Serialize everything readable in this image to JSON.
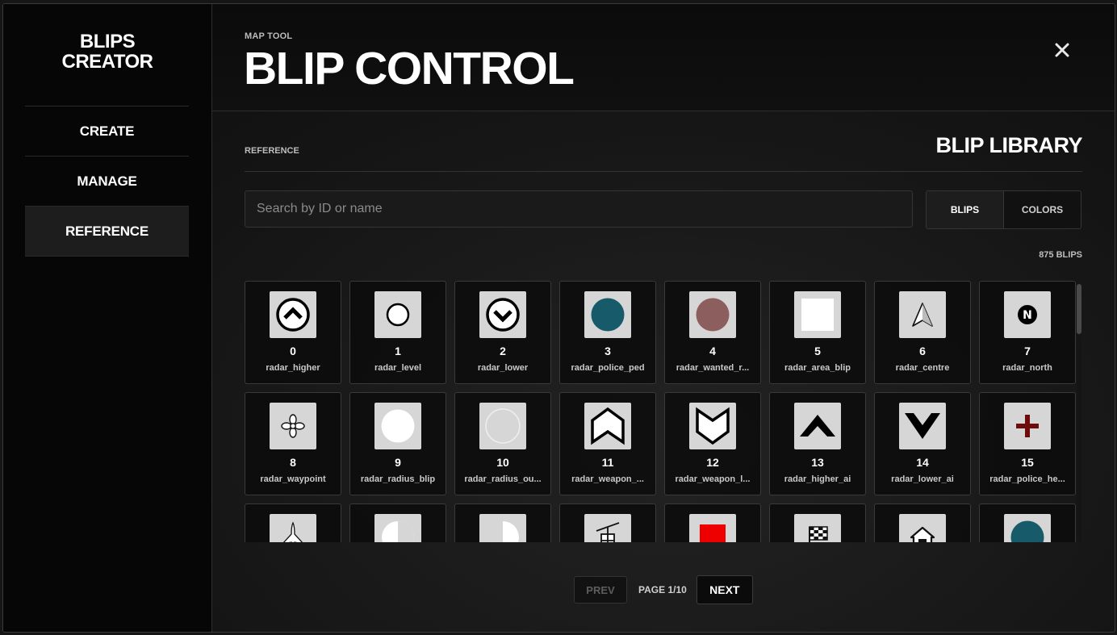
{
  "brand": {
    "line1": "BLIPS",
    "line2": "CREATOR"
  },
  "nav": [
    {
      "label": "CREATE",
      "active": false
    },
    {
      "label": "MANAGE",
      "active": false
    },
    {
      "label": "REFERENCE",
      "active": true
    }
  ],
  "header": {
    "eyebrow": "MAP TOOL",
    "title": "BLIP CONTROL"
  },
  "section": {
    "label": "REFERENCE",
    "title": "BLIP LIBRARY"
  },
  "search": {
    "placeholder": "Search by ID or name",
    "value": ""
  },
  "toggle": {
    "blips": "BLIPS",
    "colors": "COLORS",
    "selected": "BLIPS"
  },
  "count": "875 BLIPS",
  "blips": [
    {
      "id": "0",
      "name": "radar_higher",
      "icon": "circle-chevron-up-icon"
    },
    {
      "id": "1",
      "name": "radar_level",
      "icon": "circle-outline-icon"
    },
    {
      "id": "2",
      "name": "radar_lower",
      "icon": "circle-chevron-down-icon"
    },
    {
      "id": "3",
      "name": "radar_police_ped",
      "icon": "teal-dot-icon"
    },
    {
      "id": "4",
      "name": "radar_wanted_r...",
      "icon": "mauve-dot-icon"
    },
    {
      "id": "5",
      "name": "radar_area_blip",
      "icon": "white-square-icon"
    },
    {
      "id": "6",
      "name": "radar_centre",
      "icon": "navigation-arrow-icon"
    },
    {
      "id": "7",
      "name": "radar_north",
      "icon": "north-marker-icon"
    },
    {
      "id": "8",
      "name": "radar_waypoint",
      "icon": "waypoint-icon"
    },
    {
      "id": "9",
      "name": "radar_radius_blip",
      "icon": "white-circle-icon"
    },
    {
      "id": "10",
      "name": "radar_radius_ou...",
      "icon": "faint-circle-icon"
    },
    {
      "id": "11",
      "name": "radar_weapon_...",
      "icon": "chevron-up-outline-icon"
    },
    {
      "id": "12",
      "name": "radar_weapon_l...",
      "icon": "chevron-down-outline-icon"
    },
    {
      "id": "13",
      "name": "radar_higher_ai",
      "icon": "chevron-up-solid-icon"
    },
    {
      "id": "14",
      "name": "radar_lower_ai",
      "icon": "chevron-down-solid-icon"
    },
    {
      "id": "15",
      "name": "radar_police_he...",
      "icon": "red-cross-icon"
    },
    {
      "id": "",
      "name": "",
      "icon": "jet-icon"
    },
    {
      "id": "",
      "name": "",
      "icon": "half-circle-left-icon"
    },
    {
      "id": "",
      "name": "",
      "icon": "half-circle-right-icon"
    },
    {
      "id": "",
      "name": "",
      "icon": "cable-car-icon"
    },
    {
      "id": "",
      "name": "",
      "icon": "red-square-icon"
    },
    {
      "id": "",
      "name": "",
      "icon": "checkered-flag-icon"
    },
    {
      "id": "",
      "name": "",
      "icon": "safehouse-icon"
    },
    {
      "id": "",
      "name": "",
      "icon": "teal-dot-icon"
    }
  ],
  "pager": {
    "prev": "PREV",
    "page": "PAGE 1/10",
    "next": "NEXT"
  },
  "colors": {
    "teal": "#175b6b",
    "mauve": "#8c5e5e",
    "red": "#ee0000",
    "darkred": "#6e0b0b"
  }
}
